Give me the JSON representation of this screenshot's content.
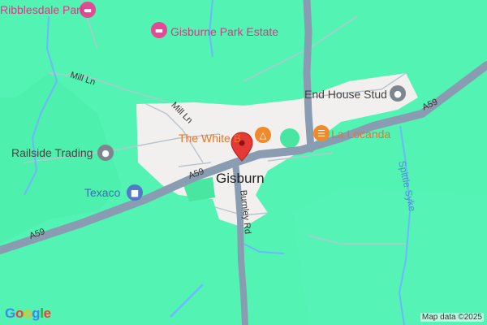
{
  "map": {
    "places": {
      "town": "Gisburn",
      "ribblesdale": "Ribblesdale Park",
      "estate": "Gisburne Park Estate",
      "end_house": "End House Stud",
      "white_bull": "The White B",
      "la_locanda": "La Locanda",
      "railside": "Railside Trading",
      "texaco": "Texaco"
    },
    "roads": {
      "a59_west": "A59",
      "a59_mid": "A59",
      "a59_east": "A59",
      "mill_ln_a": "Mill Ln",
      "mill_ln_b": "Mill Ln",
      "burnley_rd": "Burnley Rd"
    },
    "water": {
      "stream": "Spittle Syke"
    },
    "icons": {
      "ribblesdale": "hotel-icon",
      "estate": "hotel-icon",
      "end_house": "place-icon",
      "white_bull": "bar-icon",
      "la_locanda": "restaurant-icon",
      "railside": "place-icon",
      "texaco": "fuel-icon",
      "pin": "location-pin-icon"
    },
    "colors": {
      "land": "#52f3b3",
      "urban": "#f2f0ee",
      "road": "#8a9cb1",
      "water": "#6db7ff",
      "pin": "#e53935"
    },
    "attribution": "Map data ©2025",
    "logo": [
      "G",
      "o",
      "o",
      "g",
      "l",
      "e"
    ]
  }
}
